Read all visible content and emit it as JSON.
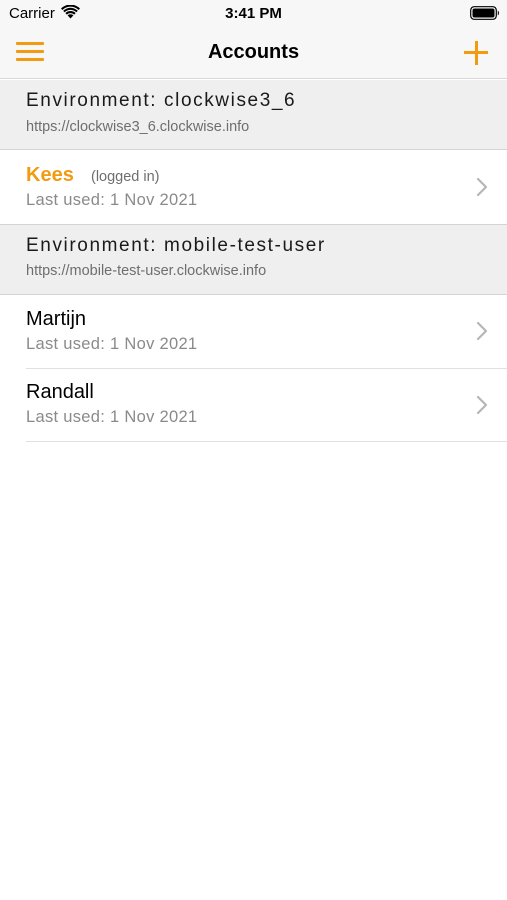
{
  "status_bar": {
    "carrier": "Carrier",
    "time": "3:41 PM"
  },
  "nav": {
    "title": "Accounts",
    "left_icon": "hamburger-menu-icon",
    "right_icon": "plus-icon",
    "accent_color": "#f29b11"
  },
  "environments": [
    {
      "title": "Environment: clockwise3_6",
      "url": "https://clockwise3_6.clockwise.info",
      "accounts": [
        {
          "name": "Kees",
          "status": "(logged in)",
          "last_used": "Last used: 1 Nov 2021",
          "active": true
        }
      ]
    },
    {
      "title": "Environment: mobile-test-user",
      "url": "https://mobile-test-user.clockwise.info",
      "accounts": [
        {
          "name": "Martijn",
          "last_used": "Last used: 1 Nov 2021",
          "active": false
        },
        {
          "name": "Randall",
          "last_used": "Last used: 1 Nov 2021",
          "active": false
        }
      ]
    }
  ]
}
